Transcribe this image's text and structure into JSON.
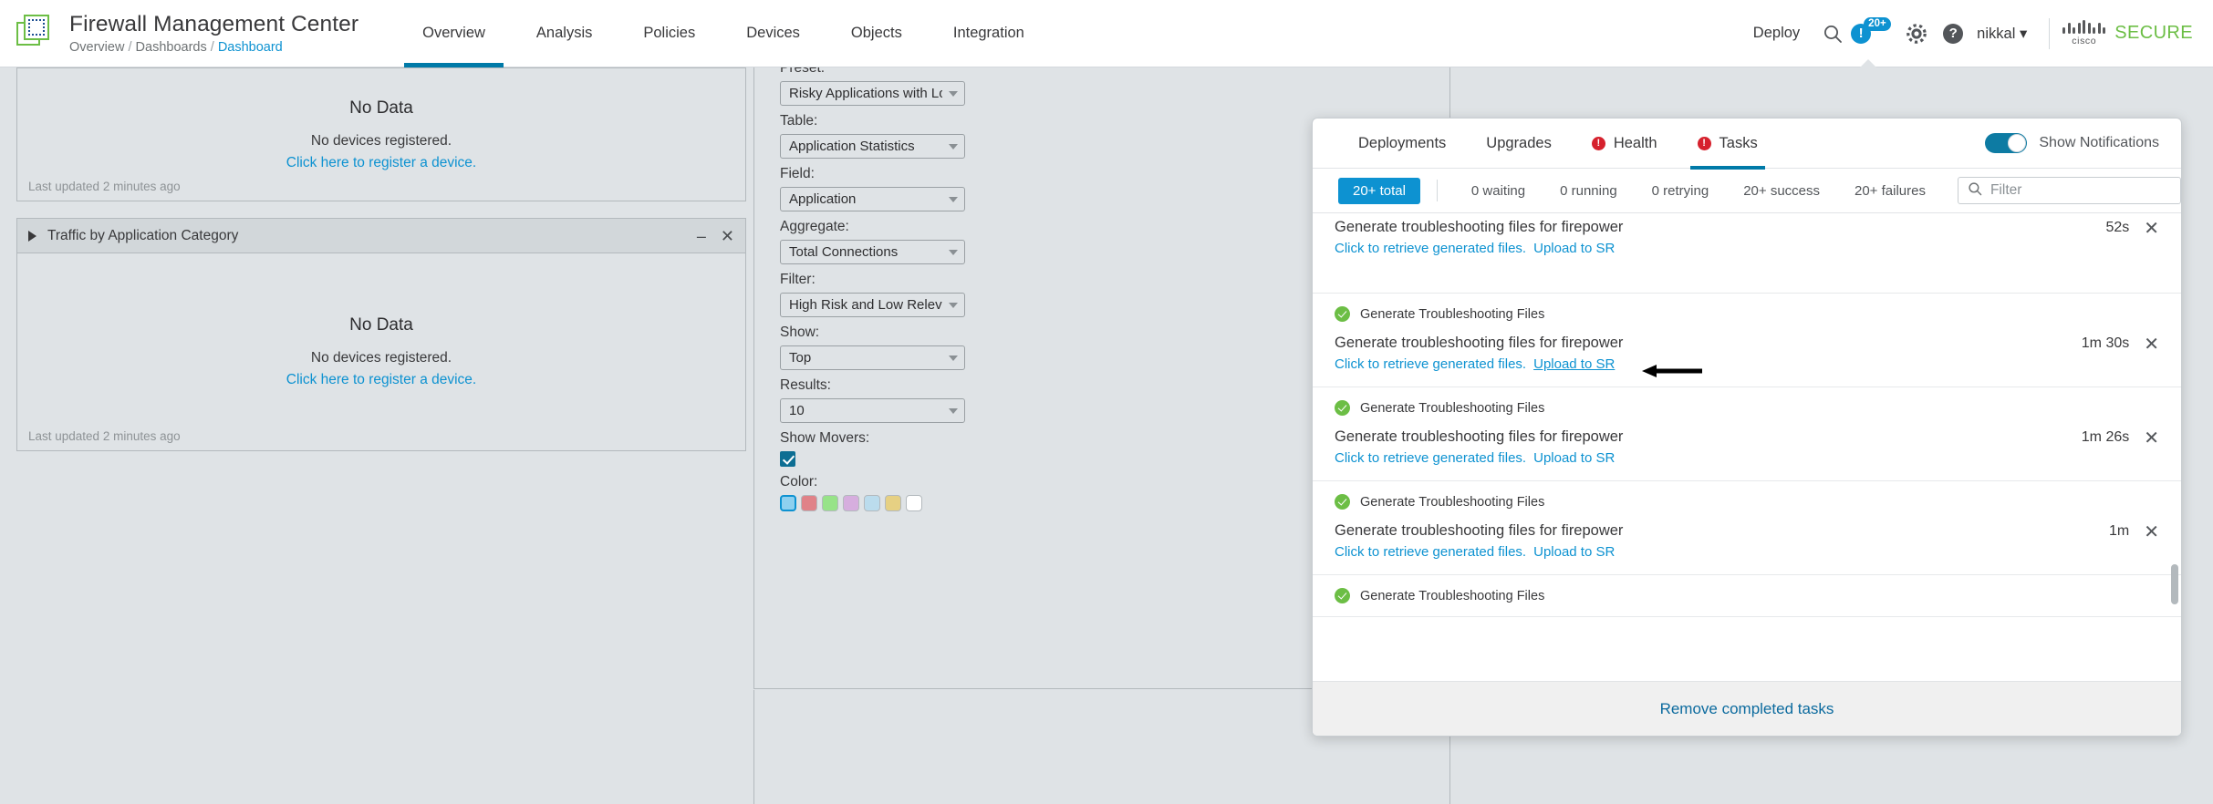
{
  "header": {
    "logo_icon": "firewall-logo-icon",
    "product_title": "Firewall Management Center",
    "breadcrumb": {
      "part1": "Overview",
      "sep1": " / ",
      "part2": "Dashboards",
      "sep2": " / ",
      "current": "Dashboard"
    },
    "nav": [
      {
        "label": "Overview",
        "active": true
      },
      {
        "label": "Analysis",
        "active": false
      },
      {
        "label": "Policies",
        "active": false
      },
      {
        "label": "Devices",
        "active": false
      },
      {
        "label": "Objects",
        "active": false
      },
      {
        "label": "Integration",
        "active": false
      }
    ],
    "deploy_label": "Deploy",
    "search_icon": "search-icon",
    "notification_icon": "notification-alert-icon",
    "notification_badge": "20+",
    "gear_icon": "gear-icon",
    "help_icon": "help-icon",
    "user_name": "nikkal",
    "user_caret": "▾",
    "cisco_word": "cisco",
    "cisco_secure": "SECURE",
    "accent_blue": "#0d92d1",
    "brand_green": "#6cbe45"
  },
  "dashboard": {
    "widgets": [
      {
        "title": "",
        "has_header": false,
        "no_data_title": "No Data",
        "no_data_line": "No devices registered.",
        "no_data_link": "Click here to register a device.",
        "footer": "Last updated 2 minutes ago"
      },
      {
        "title": "Traffic by Application Category",
        "has_header": true,
        "collapse_icon": "expand-triangle-icon",
        "minimize_icon": "minimize-icon",
        "close_icon": "close-icon",
        "minimize_label": "–",
        "close_label": "✕",
        "no_data_title": "No Data",
        "no_data_line": "No devices registered.",
        "no_data_link": "Click here to register a device.",
        "footer": "Last updated 2 minutes ago"
      }
    ]
  },
  "widget_form": {
    "fields": [
      {
        "label": "Preset:",
        "value": "Risky Applications with Low Bus"
      },
      {
        "label": "Table:",
        "value": "Application Statistics"
      },
      {
        "label": "Field:",
        "value": "Application"
      },
      {
        "label": "Aggregate:",
        "value": "Total Connections"
      },
      {
        "label": "Filter:",
        "value": "High Risk and Low Relevance"
      },
      {
        "label": "Show:",
        "value": "Top"
      },
      {
        "label": "Results:",
        "value": "10"
      }
    ],
    "show_movers_label": "Show Movers:",
    "show_movers_checked": true,
    "color_label": "Color:",
    "colors": [
      {
        "hex": "#8ed0ef",
        "selected": true
      },
      {
        "hex": "#e08288",
        "selected": false
      },
      {
        "hex": "#97e388",
        "selected": false
      },
      {
        "hex": "#d6aede",
        "selected": false
      },
      {
        "hex": "#bbdced",
        "selected": false
      },
      {
        "hex": "#e6d083",
        "selected": false
      },
      {
        "hex": "#ffffff",
        "selected": false
      }
    ]
  },
  "notifications": {
    "tabs": [
      {
        "label": "Deployments",
        "active": false,
        "has_error_dot": false
      },
      {
        "label": "Upgrades",
        "active": false,
        "has_error_dot": false
      },
      {
        "label": "Health",
        "active": false,
        "has_error_dot": true
      },
      {
        "label": "Tasks",
        "active": true,
        "has_error_dot": true
      }
    ],
    "error_dot_glyph": "!",
    "toggle_label": "Show Notifications",
    "toggle_on": true,
    "filters": {
      "total": "20+ total",
      "chips": [
        "0 waiting",
        "0 running",
        "0 retrying",
        "20+ success",
        "20+ failures"
      ],
      "search_icon": "search-icon",
      "search_placeholder": "Filter",
      "search_value": ""
    },
    "tasks": [
      {
        "type_label": "",
        "show_type": false,
        "title": "Generate troubleshooting files for firepower",
        "link_retrieve": "Click to retrieve generated files.",
        "link_upload": "Upload to SR",
        "upload_underlined": false,
        "duration": "52s",
        "close_glyph": "✕"
      },
      {
        "type_label": "Generate Troubleshooting Files",
        "show_type": true,
        "title": "Generate troubleshooting files for firepower",
        "link_retrieve": "Click to retrieve generated files.",
        "link_upload": "Upload to SR",
        "upload_underlined": true,
        "duration": "1m 30s",
        "close_glyph": "✕"
      },
      {
        "type_label": "Generate Troubleshooting Files",
        "show_type": true,
        "title": "Generate troubleshooting files for firepower",
        "link_retrieve": "Click to retrieve generated files.",
        "link_upload": "Upload to SR",
        "upload_underlined": false,
        "duration": "1m 26s",
        "close_glyph": "✕"
      },
      {
        "type_label": "Generate Troubleshooting Files",
        "show_type": true,
        "title": "Generate troubleshooting files for firepower",
        "link_retrieve": "Click to retrieve generated files.",
        "link_upload": "Upload to SR",
        "upload_underlined": false,
        "duration": "1m",
        "close_glyph": "✕"
      },
      {
        "type_label": "Generate Troubleshooting Files",
        "show_type": true,
        "title": "",
        "link_retrieve": "",
        "link_upload": "",
        "upload_underlined": false,
        "duration": "",
        "close_glyph": ""
      }
    ],
    "footer_link": "Remove completed tasks"
  },
  "annotation": {
    "arrow_icon": "pointer-arrow-icon"
  }
}
